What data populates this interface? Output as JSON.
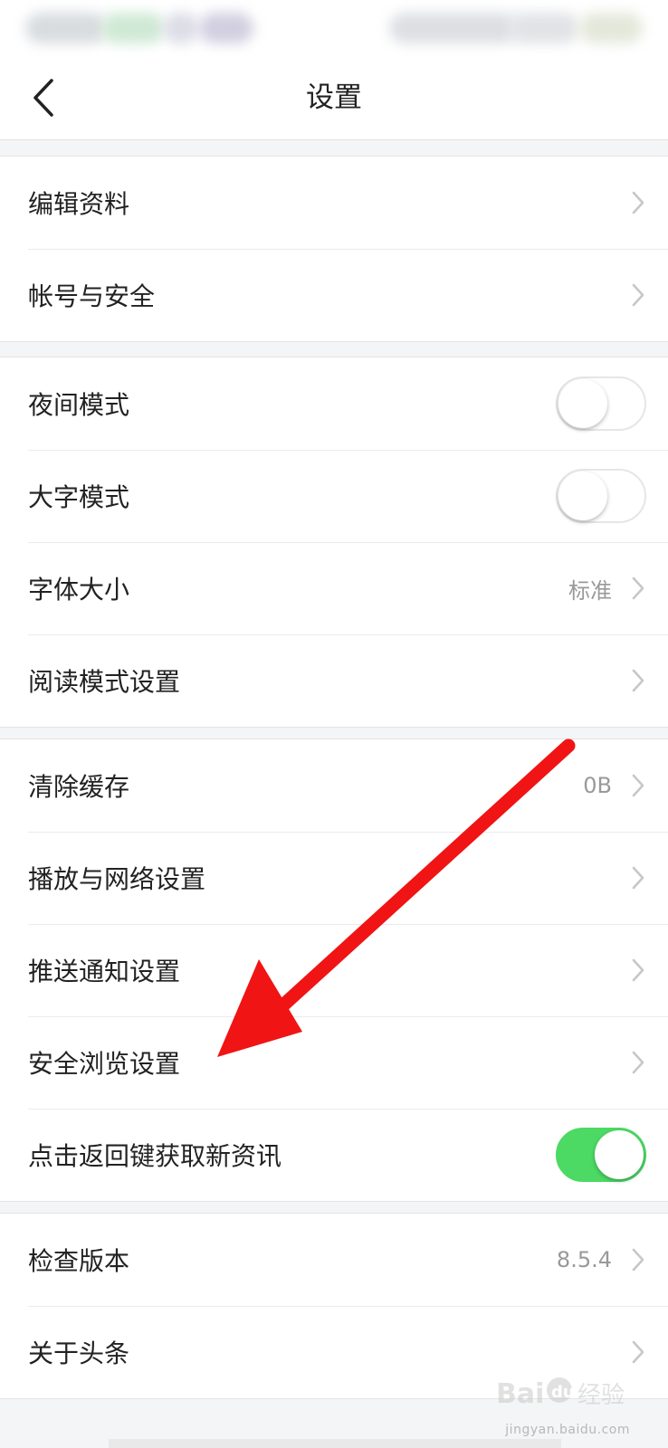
{
  "header": {
    "title": "设置"
  },
  "groups": [
    {
      "items": [
        {
          "label": "编辑资料"
        },
        {
          "label": "帐号与安全"
        }
      ]
    },
    {
      "items": [
        {
          "label": "夜间模式",
          "toggle": false
        },
        {
          "label": "大字模式",
          "toggle": false
        },
        {
          "label": "字体大小",
          "value": "标准"
        },
        {
          "label": "阅读模式设置"
        }
      ]
    },
    {
      "items": [
        {
          "label": "清除缓存",
          "value": "0B"
        },
        {
          "label": "播放与网络设置"
        },
        {
          "label": "推送通知设置"
        },
        {
          "label": "安全浏览设置"
        },
        {
          "label": "点击返回键获取新资讯",
          "toggle": true
        }
      ]
    },
    {
      "items": [
        {
          "label": "检查版本",
          "value": "8.5.4"
        },
        {
          "label": "关于头条"
        }
      ]
    }
  ],
  "watermark": {
    "sub": "jingyan.baidu.com"
  },
  "colors": {
    "toggle_on": "#4cd964",
    "annotation_arrow": "#f01414"
  },
  "icons": {
    "back": "back-arrow-icon",
    "row": "chevron-right-icon"
  }
}
